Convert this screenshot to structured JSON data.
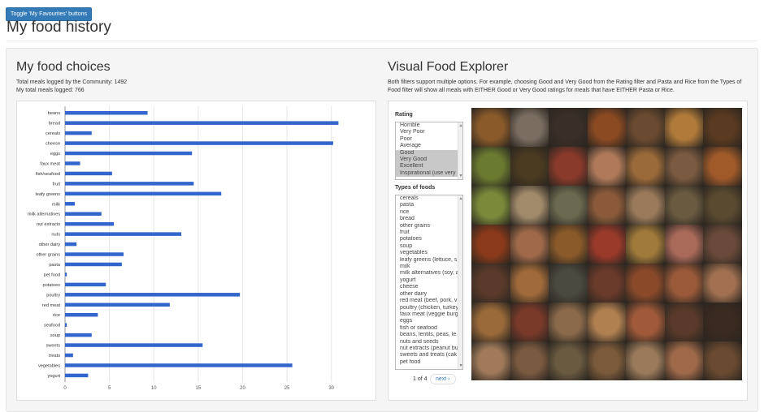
{
  "toggle_button": "Toggle 'My Favourites' buttons",
  "page_title": "My food history",
  "choices": {
    "title": "My food choices",
    "community_total": "Total meals logged by the Community: 1492",
    "my_total": "My total meals logged: 766"
  },
  "explorer": {
    "title": "Visual Food Explorer",
    "description": "Both filters support multiple options. For example, choosing Good and Very Good from the Rating filter and Pasta and Rice from the Types of Food filter will show all meals with EITHER Good or Very Good ratings for meals that have EITHER Pasta or Rice.",
    "rating_label": "Rating",
    "rating_options": [
      "Horrible",
      "Very Poor",
      "Poor",
      "Average",
      "Good",
      "Very Good",
      "Excellent",
      "Inspirational (use very"
    ],
    "rating_selected": [
      "Good",
      "Very Good",
      "Excellent",
      "Inspirational (use very"
    ],
    "types_label": "Types of foods",
    "types_options": [
      "cereals",
      "pasta",
      "rice",
      "bread",
      "other grains",
      "fruit",
      "potatoes",
      "soup",
      "vegetables",
      "leafy greens (lettuce, s",
      "milk",
      "milk alternatives (soy, a",
      "yogurt",
      "cheese",
      "other dairy",
      "red meat (beef, pork, v",
      "poultry (chicken, turkey",
      "faux meat (veggie burg",
      "eggs",
      "fish or seafood",
      "beans, lentils, peas, le",
      "nuts and seeds",
      "nut extracts (peanut bu",
      "sweets and treats (cak",
      "pet food"
    ],
    "pager_text": "1 of 4",
    "next_label": "next ›"
  },
  "chart_data": {
    "type": "bar",
    "orientation": "horizontal",
    "categories": [
      "beans",
      "bread",
      "cereals",
      "cheese",
      "eggs",
      "faux meat",
      "fish/seafood",
      "fruit",
      "leafy greens",
      "milk",
      "milk alternatives",
      "nut extracts",
      "nuts",
      "other dairy",
      "other grains",
      "pasta",
      "pet food",
      "potatoes",
      "poultry",
      "red meat",
      "rice",
      "seafood",
      "soup",
      "sweets",
      "treats",
      "vegetables",
      "yogurt"
    ],
    "values": [
      9.3,
      30.8,
      3.0,
      30.2,
      14.3,
      1.7,
      5.3,
      14.5,
      17.6,
      1.1,
      4.1,
      5.5,
      13.1,
      1.3,
      6.6,
      6.4,
      0.2,
      4.6,
      19.7,
      11.8,
      3.7,
      0.2,
      3.0,
      15.5,
      0.9,
      25.6,
      2.6
    ],
    "xticks": [
      0,
      5,
      10,
      15,
      20,
      25,
      30
    ],
    "xlim": [
      0,
      32.5
    ],
    "bar_color": "#3366cc",
    "grid": true
  },
  "photo_colors": [
    "#8a5a2a",
    "#7a6e60",
    "#3a2e28",
    "#8b4a22",
    "#6a4a30",
    "#b07a3a",
    "#5a3a20",
    "#6a7a30",
    "#4a3a20",
    "#8a3a2a",
    "#b07a5a",
    "#9a6a3a",
    "#7a5a40",
    "#a05a2a",
    "#7a8a3a",
    "#a08a6a",
    "#6a6a50",
    "#8a5a3a",
    "#9a7a5a",
    "#6a5a40",
    "#5a4a30",
    "#8a3a1a",
    "#a06a4a",
    "#8a5a2a",
    "#9a3a2a",
    "#a07a3a",
    "#aa6a5a",
    "#6a4a3a",
    "#5a3a2a",
    "#a06a3a",
    "#4a4a40",
    "#6a3a2a",
    "#8a4a2a",
    "#9a5a3a",
    "#a07050",
    "#9a6a3a",
    "#7a3a2a",
    "#8a6a4a",
    "#b08050",
    "#a05a3a",
    "#5a3a2a",
    "#3a2a20",
    "#a07a5a",
    "#7a5a40",
    "#6a5a40",
    "#7a5a3a",
    "#9a7a5a",
    "#a06a4a",
    "#6a4a30"
  ]
}
